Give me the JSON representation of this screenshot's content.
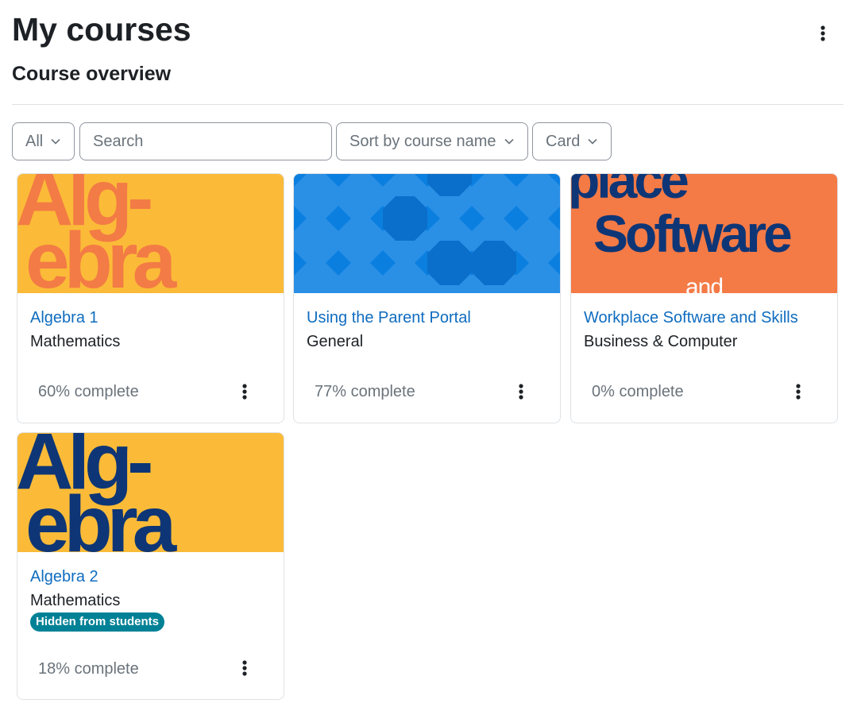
{
  "page": {
    "title": "My courses"
  },
  "section": {
    "title": "Course overview"
  },
  "filters": {
    "grouping": "All",
    "search_placeholder": "Search",
    "search_value": "",
    "sort": "Sort by course name",
    "view": "Card"
  },
  "courses": [
    {
      "name": "Algebra 1",
      "category": "Mathematics",
      "progress_text": "60% complete",
      "progress_percent": 60,
      "hidden_badge": "",
      "image_text": [
        "Alg-",
        "ebra"
      ],
      "image_bg": "#fbbb38",
      "image_fg": "#f37b45"
    },
    {
      "name": "Using the Parent Portal",
      "category": "General",
      "progress_text": "77% complete",
      "progress_percent": 77,
      "hidden_badge": "",
      "image_text": [],
      "image_bg": "#0b7fe0",
      "image_fg": "#2a90e6"
    },
    {
      "name": "Workplace Software and Skills",
      "category": "Business & Computer",
      "progress_text": "0% complete",
      "progress_percent": 0,
      "hidden_badge": "",
      "image_text": [
        "place",
        "Software",
        "and"
      ],
      "image_bg": "#f47a46",
      "image_fg": "#0e3676"
    },
    {
      "name": "Algebra 2",
      "category": "Mathematics",
      "progress_text": "18% complete",
      "progress_percent": 18,
      "hidden_badge": "Hidden from students",
      "image_text": [
        "Alg-",
        "ebra"
      ],
      "image_bg": "#fbbb38",
      "image_fg": "#0e3676"
    }
  ],
  "icons": {
    "page_menu": "kebab-vertical-icon",
    "dropdown": "chevron-down-icon",
    "course_menu": "kebab-vertical-icon"
  },
  "colors": {
    "link": "#0f6cbf",
    "badge": "#008196",
    "text": "#1d2125",
    "muted": "#6a737b",
    "border": "#dee2e6"
  }
}
